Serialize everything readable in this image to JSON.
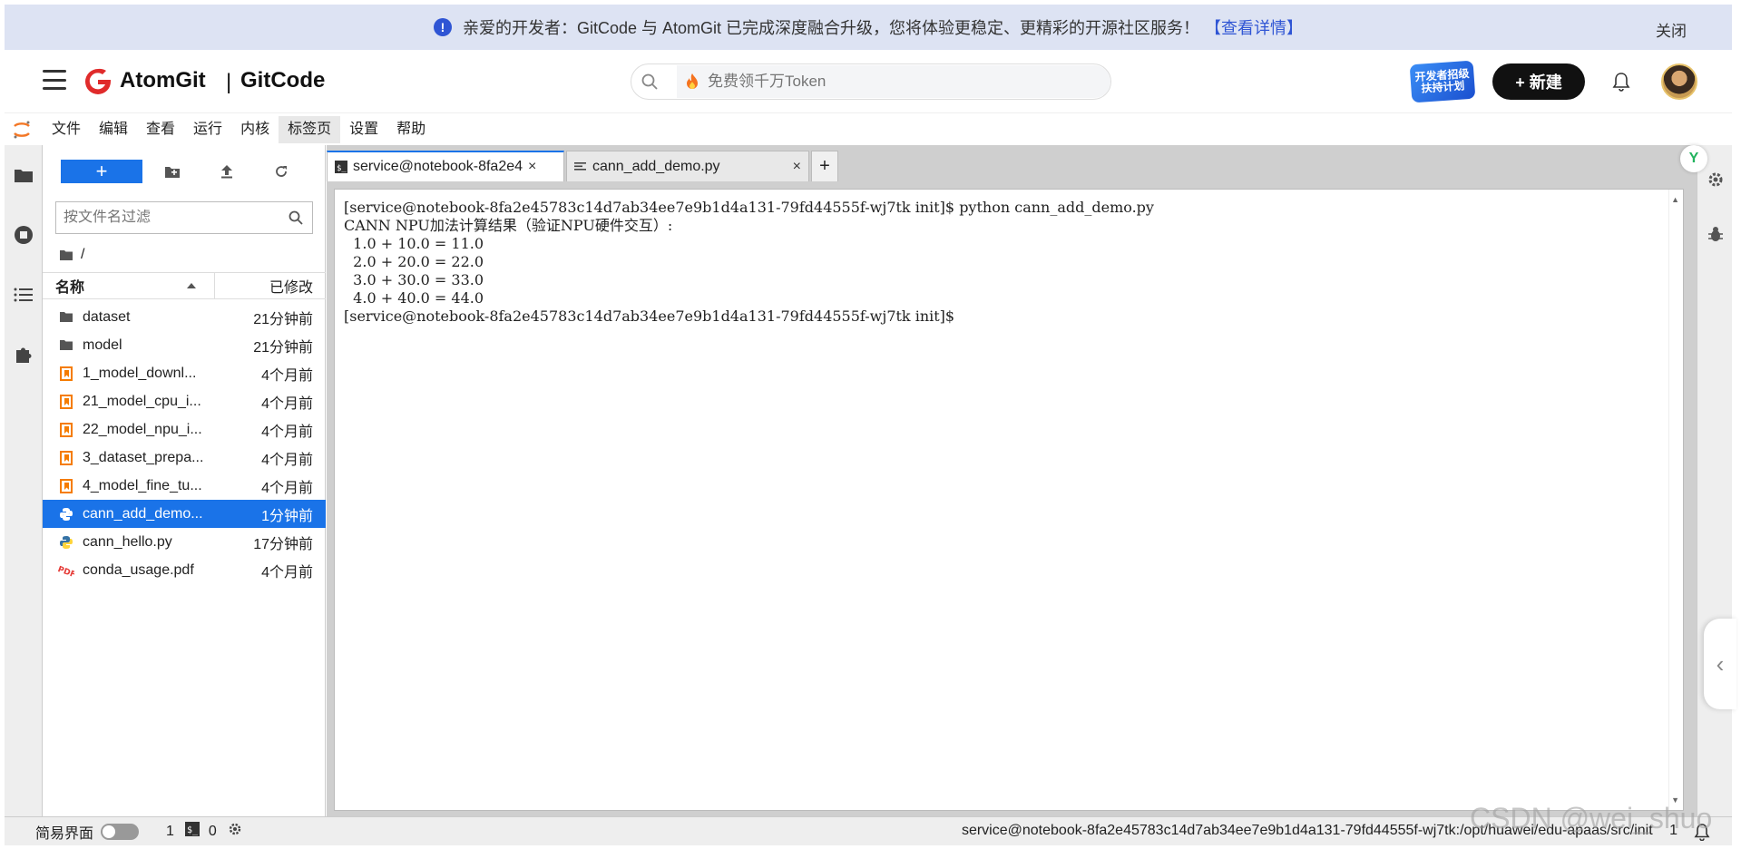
{
  "banner": {
    "message": "亲爱的开发者：GitCode 与 AtomGit 已完成深度融合升级，您将体验更稳定、更精彩的开源社区服务！",
    "link": "【查看详情】",
    "close": "关闭"
  },
  "header": {
    "logo_primary": "AtomGit",
    "logo_divider": "|",
    "logo_secondary": "GitCode",
    "search_placeholder": "免费领千万Token",
    "promo_text": "开发者招级 扶持计划",
    "new_button": "+ 新建"
  },
  "menu": {
    "items": [
      "文件",
      "编辑",
      "查看",
      "运行",
      "内核",
      "标签页",
      "设置",
      "帮助"
    ],
    "active_index": 5
  },
  "filebrowser": {
    "add_label": "+",
    "filter_placeholder": "按文件名过滤",
    "breadcrumb": "/",
    "col_name": "名称",
    "col_modified": "已修改",
    "files": [
      {
        "name": "dataset",
        "modified": "21分钟前",
        "type": "folder"
      },
      {
        "name": "model",
        "modified": "21分钟前",
        "type": "folder"
      },
      {
        "name": "1_model_downl...",
        "modified": "4个月前",
        "type": "notebook"
      },
      {
        "name": "21_model_cpu_i...",
        "modified": "4个月前",
        "type": "notebook"
      },
      {
        "name": "22_model_npu_i...",
        "modified": "4个月前",
        "type": "notebook"
      },
      {
        "name": "3_dataset_prepa...",
        "modified": "4个月前",
        "type": "notebook"
      },
      {
        "name": "4_model_fine_tu...",
        "modified": "4个月前",
        "type": "notebook"
      },
      {
        "name": "cann_add_demo...",
        "modified": "1分钟前",
        "type": "python",
        "selected": true
      },
      {
        "name": "cann_hello.py",
        "modified": "17分钟前",
        "type": "python"
      },
      {
        "name": "conda_usage.pdf",
        "modified": "4个月前",
        "type": "pdf"
      }
    ]
  },
  "tabs": [
    {
      "label": "service@notebook-8fa2e4",
      "close": "×",
      "type": "terminal"
    },
    {
      "label": "cann_add_demo.py",
      "close": "×",
      "type": "editor"
    }
  ],
  "tab_add": "+",
  "terminal": {
    "lines": [
      "[service@notebook-8fa2e45783c14d7ab34ee7e9b1d4a131-79fd44555f-wj7tk init]$ python cann_add_demo.py",
      "CANN NPU加法计算结果（验证NPU硬件交互）:",
      "  1.0 + 10.0 = 11.0",
      "  2.0 + 20.0 = 22.0",
      "  3.0 + 30.0 = 33.0",
      "  4.0 + 40.0 = 44.0",
      "[service@notebook-8fa2e45783c14d7ab34ee7e9b1d4a131-79fd44555f-wj7tk init]$"
    ]
  },
  "statusbar": {
    "simple_mode": "简易界面",
    "count1": "1",
    "count2": "0",
    "path": "service@notebook-8fa2e45783c14d7ab34ee7e9b1d4a131-79fd44555f-wj7tk:/opt/huawei/edu-apaas/src/init",
    "line_col": "1"
  },
  "watermark": "CSDN @wei_shuo",
  "colors": {
    "accent": "#1a73e8",
    "banner_bg": "#dde3f3",
    "selected_row": "#1a73e8",
    "notebook_icon": "#f57c00",
    "pdf_icon": "#e53935"
  }
}
